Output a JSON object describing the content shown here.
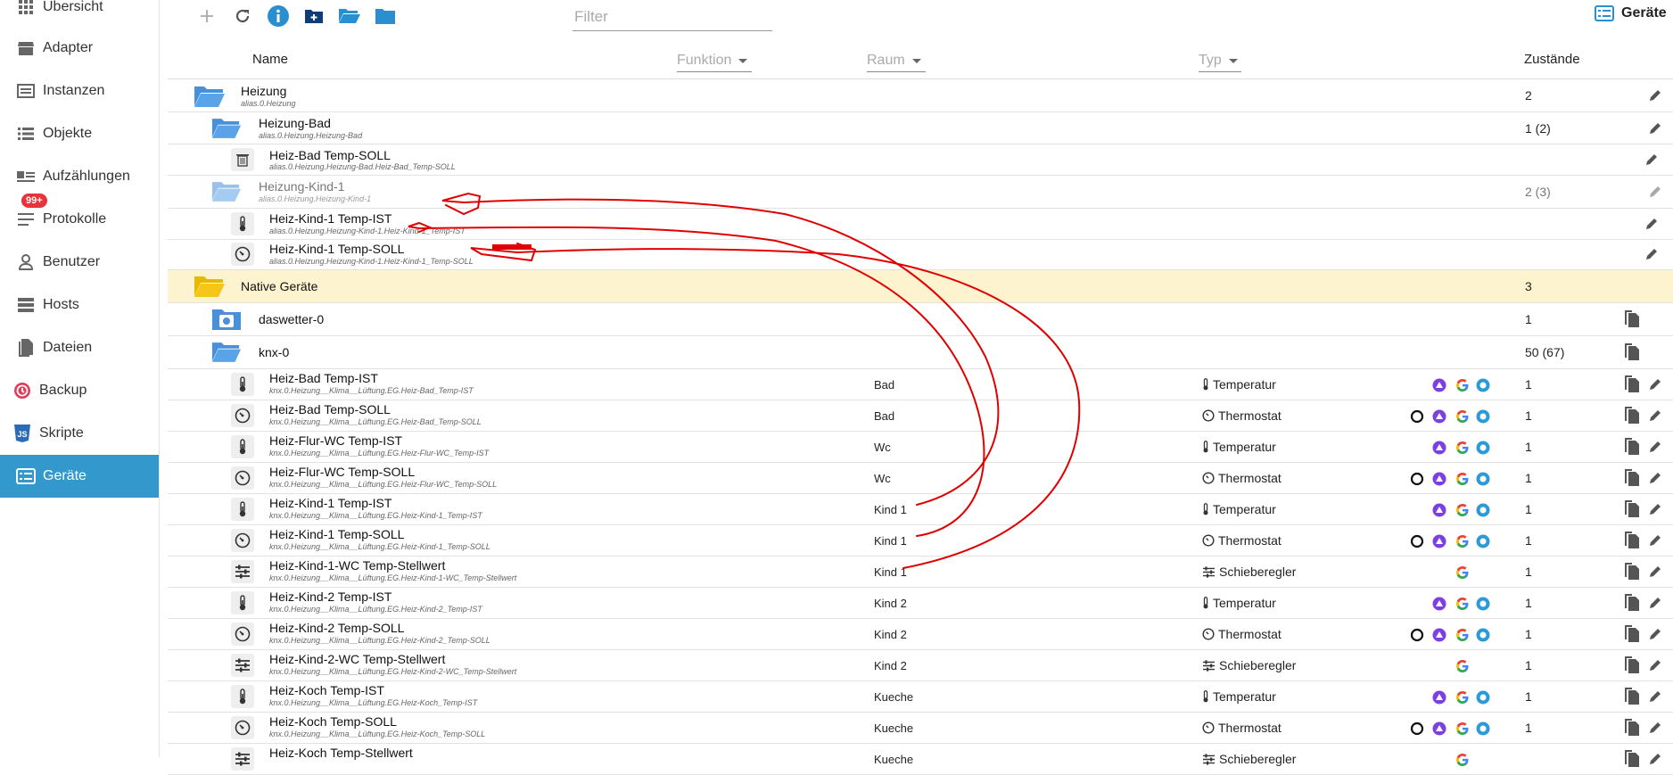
{
  "sidebar": {
    "items": [
      {
        "label": "Übersicht",
        "icon": "grid-icon"
      },
      {
        "label": "Adapter",
        "icon": "store-icon"
      },
      {
        "label": "Instanzen",
        "icon": "instances-icon"
      },
      {
        "label": "Objekte",
        "icon": "list-icon"
      },
      {
        "label": "Aufzählungen",
        "icon": "enum-icon"
      },
      {
        "label": "Protokolle",
        "icon": "log-icon",
        "badge": "99+"
      },
      {
        "label": "Benutzer",
        "icon": "user-icon"
      },
      {
        "label": "Hosts",
        "icon": "hosts-icon"
      },
      {
        "label": "Dateien",
        "icon": "files-icon"
      },
      {
        "label": "Backup",
        "icon": "backup-icon"
      },
      {
        "label": "Skripte",
        "icon": "js-icon"
      },
      {
        "label": "Geräte",
        "icon": "devices-icon",
        "active": true
      }
    ]
  },
  "toolbar": {
    "filter_placeholder": "Filter",
    "title": "Geräte"
  },
  "header": {
    "name": "Name",
    "funktion": "Funktion",
    "raum": "Raum",
    "typ": "Typ",
    "zustaende": "Zustände"
  },
  "rows": [
    {
      "name": "Heizung",
      "id": "alias.0.Heizung",
      "state": "2"
    },
    {
      "name": "Heizung-Bad",
      "id": "alias.0.Heizung.Heizung-Bad",
      "state": "1 (2)"
    },
    {
      "name": "Heiz-Bad Temp-SOLL",
      "id": "alias.0.Heizung.Heizung-Bad.Heiz-Bad_Temp-SOLL",
      "state": ""
    },
    {
      "name": "Heizung-Kind-1",
      "id": "alias.0.Heizung.Heizung-Kind-1",
      "state": "2 (3)"
    },
    {
      "name": "Heiz-Kind-1 Temp-IST",
      "id": "alias.0.Heizung.Heizung-Kind-1.Heiz-Kind-1_Temp-IST",
      "state": ""
    },
    {
      "name": "Heiz-Kind-1 Temp-SOLL",
      "id": "alias.0.Heizung.Heizung-Kind-1.Heiz-Kind-1_Temp-SOLL",
      "state": ""
    },
    {
      "name": "Native Geräte",
      "id": "",
      "state": "3"
    },
    {
      "name": "daswetter-0",
      "id": "",
      "state": "1"
    },
    {
      "name": "knx-0",
      "id": "",
      "state": "50 (67)"
    },
    {
      "name": "Heiz-Bad Temp-IST",
      "id": "knx.0.Heizung__Klima__Lüftung.EG.Heiz-Bad_Temp-IST",
      "room": "Bad",
      "type": "Temperatur",
      "state": "1"
    },
    {
      "name": "Heiz-Bad Temp-SOLL",
      "id": "knx.0.Heizung__Klima__Lüftung.EG.Heiz-Bad_Temp-SOLL",
      "room": "Bad",
      "type": "Thermostat",
      "state": "1"
    },
    {
      "name": "Heiz-Flur-WC Temp-IST",
      "id": "knx.0.Heizung__Klima__Lüftung.EG.Heiz-Flur-WC_Temp-IST",
      "room": "Wc",
      "type": "Temperatur",
      "state": "1"
    },
    {
      "name": "Heiz-Flur-WC Temp-SOLL",
      "id": "knx.0.Heizung__Klima__Lüftung.EG.Heiz-Flur-WC_Temp-SOLL",
      "room": "Wc",
      "type": "Thermostat",
      "state": "1"
    },
    {
      "name": "Heiz-Kind-1 Temp-IST",
      "id": "knx.0.Heizung__Klima__Lüftung.EG.Heiz-Kind-1_Temp-IST",
      "room": "Kind 1",
      "type": "Temperatur",
      "state": "1"
    },
    {
      "name": "Heiz-Kind-1 Temp-SOLL",
      "id": "knx.0.Heizung__Klima__Lüftung.EG.Heiz-Kind-1_Temp-SOLL",
      "room": "Kind 1",
      "type": "Thermostat",
      "state": "1"
    },
    {
      "name": "Heiz-Kind-1-WC Temp-Stellwert",
      "id": "knx.0.Heizung__Klima__Lüftung.EG.Heiz-Kind-1-WC_Temp-Stellwert",
      "room": "Kind 1",
      "type": "Schieberegler",
      "state": "1"
    },
    {
      "name": "Heiz-Kind-2 Temp-IST",
      "id": "knx.0.Heizung__Klima__Lüftung.EG.Heiz-Kind-2_Temp-IST",
      "room": "Kind 2",
      "type": "Temperatur",
      "state": "1"
    },
    {
      "name": "Heiz-Kind-2 Temp-SOLL",
      "id": "knx.0.Heizung__Klima__Lüftung.EG.Heiz-Kind-2_Temp-SOLL",
      "room": "Kind 2",
      "type": "Thermostat",
      "state": "1"
    },
    {
      "name": "Heiz-Kind-2-WC Temp-Stellwert",
      "id": "knx.0.Heizung__Klima__Lüftung.EG.Heiz-Kind-2-WC_Temp-Stellwert",
      "room": "Kind 2",
      "type": "Schieberegler",
      "state": "1"
    },
    {
      "name": "Heiz-Koch Temp-IST",
      "id": "knx.0.Heizung__Klima__Lüftung.EG.Heiz-Koch_Temp-IST",
      "room": "Kueche",
      "type": "Temperatur",
      "state": "1"
    },
    {
      "name": "Heiz-Koch Temp-SOLL",
      "id": "knx.0.Heizung__Klima__Lüftung.EG.Heiz-Koch_Temp-SOLL",
      "room": "Kueche",
      "type": "Thermostat",
      "state": "1"
    },
    {
      "name": "Heiz-Koch Temp-Stellwert",
      "id": "",
      "room": "Kueche",
      "type": "Schieberegler",
      "state": ""
    }
  ],
  "colors": {
    "accent": "#3399cc",
    "folder": "#4a90d9",
    "folder_native": "#f5c518",
    "annotation": "#e00000",
    "highlight": "#fdf3cf"
  }
}
